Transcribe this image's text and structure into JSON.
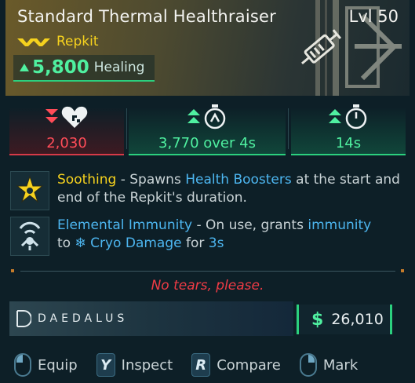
{
  "item": {
    "name": "Standard Thermal Healthraiser",
    "level": "Lvl 50",
    "rarity": "Repkit",
    "main_stat": {
      "value": "5,800",
      "label": "Healing"
    }
  },
  "stats": [
    {
      "value": "2,030",
      "change": "down",
      "color": "#ff4c58",
      "icon": "heart-icon"
    },
    {
      "value": "3,770 over 4s",
      "change": "up",
      "color": "#4ff0a0",
      "icon": "regen-timer-icon"
    },
    {
      "value": "14s",
      "change": "up",
      "color": "#4ff0a0",
      "icon": "stopwatch-icon"
    }
  ],
  "perks": [
    {
      "icon": "star-burst-icon",
      "name": "Soothing",
      "sep": " - Spawns ",
      "highlight": "Health Boosters",
      "rest": " at the start and end of the Repkit's duration."
    },
    {
      "icon": "elemental-shield-icon",
      "name": "Elemental Immunity",
      "sep": " - On use, grants ",
      "highlight": "immunity",
      "to": " to ",
      "element_icon": "snowflake-icon",
      "element": "Cryo Damage",
      "for": " for ",
      "duration": "3s"
    }
  ],
  "flavor_text": "No tears, please.",
  "manufacturer": "DAEDALUS",
  "price": {
    "symbol": "$",
    "value": "26,010"
  },
  "actions": [
    {
      "key": "mouse-left-icon",
      "label": "Equip"
    },
    {
      "key": "Y",
      "label": "Inspect"
    },
    {
      "key": "R",
      "label": "Compare"
    },
    {
      "key": "mouse-right-icon",
      "label": "Mark"
    }
  ],
  "colors": {
    "rarity_gold": "#f6d21e",
    "stat_green": "#4ff0a0",
    "stat_red": "#ff4c58",
    "link_blue": "#4db6f0",
    "flavor_red": "#ef3b45"
  }
}
